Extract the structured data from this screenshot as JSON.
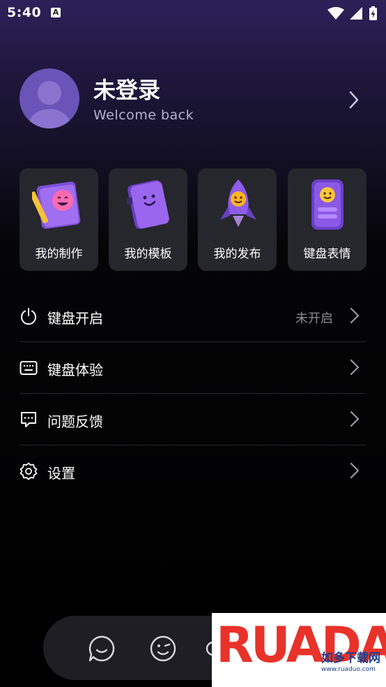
{
  "status_bar": {
    "time": "5:40",
    "notification_badge": "A"
  },
  "profile": {
    "name": "未登录",
    "subtitle": "Welcome back"
  },
  "cards": [
    {
      "label": "我的制作",
      "icon": "creation-icon"
    },
    {
      "label": "我的模板",
      "icon": "template-book-icon"
    },
    {
      "label": "我的发布",
      "icon": "rocket-icon"
    },
    {
      "label": "键盘表情",
      "icon": "emoji-device-icon"
    }
  ],
  "menu": [
    {
      "label": "键盘开启",
      "status": "未开启",
      "icon": "power-icon"
    },
    {
      "label": "键盘体验",
      "status": "",
      "icon": "keyboard-icon"
    },
    {
      "label": "问题反馈",
      "status": "",
      "icon": "feedback-icon"
    },
    {
      "label": "设置",
      "status": "",
      "icon": "settings-icon"
    }
  ],
  "watermark": {
    "brand": "RUADADO",
    "cn": "如多下载网",
    "url": "www.ruaduo.com"
  },
  "colors": {
    "accent": "#6a54b8",
    "card_bg": "#26262d",
    "bar_bg": "#1e1e24",
    "watermark_red": "#e8322a",
    "watermark_blue": "#1a3f8c"
  }
}
